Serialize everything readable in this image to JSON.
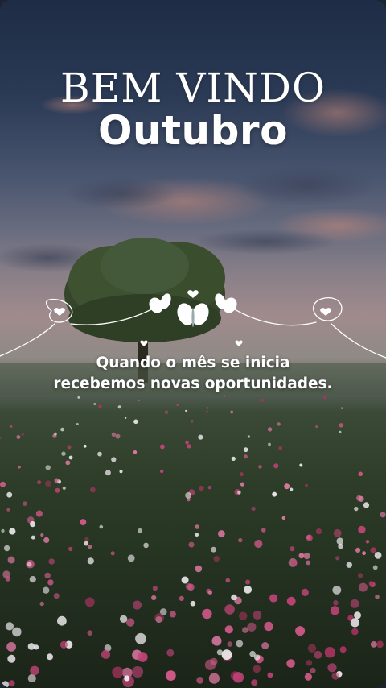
{
  "greeting": {
    "line1": "BEM VINDO",
    "line2": "Outubro"
  },
  "caption": {
    "line1": "Quando o mês se inicia",
    "line2": "recebemos novas oportunidades."
  },
  "colors": {
    "text": "#ffffff",
    "sky_top": "#1e2c45",
    "horizon": "#a08b8c",
    "meadow": "#2d3d28",
    "flower_pink": "#c4447a",
    "flower_white": "#f1eef0"
  },
  "icons": [
    "heart-icon",
    "butterfly-icon"
  ]
}
